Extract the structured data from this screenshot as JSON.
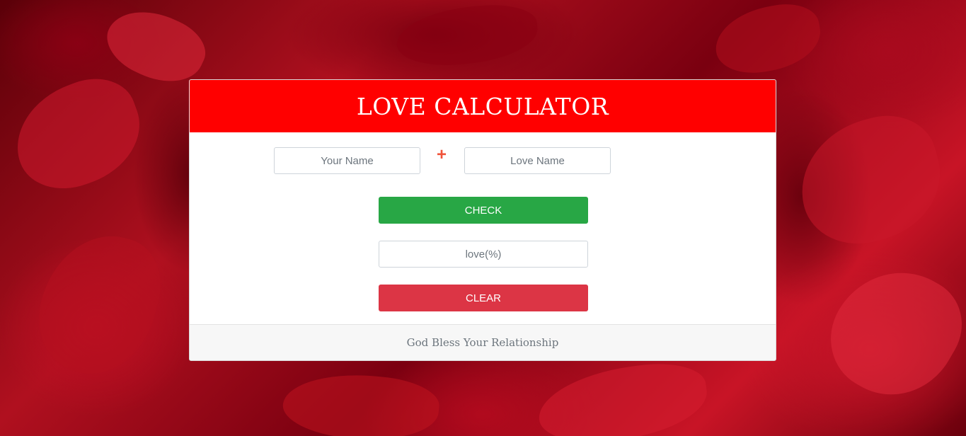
{
  "header": {
    "title": "LOVE CALCULATOR"
  },
  "form": {
    "your_name_placeholder": "Your Name",
    "plus_symbol": "+",
    "love_name_placeholder": "Love Name",
    "check_label": "CHECK",
    "result_placeholder": "love(%)",
    "clear_label": "CLEAR"
  },
  "footer": {
    "text": "God Bless Your Relationship"
  },
  "colors": {
    "header_bg": "#ff0000",
    "check_button": "#28a745",
    "clear_button": "#dc3545",
    "plus_symbol": "#f0533a"
  },
  "background": {
    "description_icon": "red-rose-petals-background"
  }
}
